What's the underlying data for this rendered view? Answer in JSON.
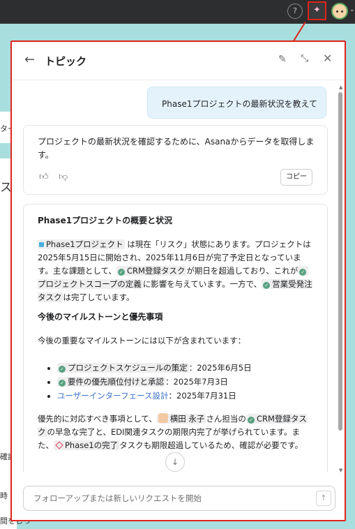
{
  "topbar": {
    "help_label": "?",
    "ai_icon": "sparkle-icon",
    "avatar_icon": "user-avatar",
    "chevron": "⌄"
  },
  "background": {
    "fragments": [
      "ター",
      "ス",
      "確認",
      "時",
      "間をしっ"
    ]
  },
  "panel": {
    "title": "トピック",
    "icons": [
      "back-arrow-icon",
      "edit-icon",
      "collapse-icon",
      "close-icon"
    ]
  },
  "conversation": {
    "user_message": "Phase1プロジェクトの最新状況を教えて",
    "assistant_intro": "プロジェクトの最新状況を確認するために、Asanaからデータを取得します。",
    "copy_label": "コピー",
    "answer": {
      "heading1": "Phase1プロジェクトの概要と状況",
      "p1": {
        "project_chip": "Phase1プロジェクト",
        "t1": "は現在「リスク」状態にあります。プロジェクトは2025年5月15日に開始され、2025年11月6日が完了予定日となっています。主な課題として、",
        "task1": "CRM登録タスク",
        "t2": "が期日を超過しており、これが",
        "task2": "プロジェクトスコープの定義",
        "t3": "に影響を与えています。一方で、",
        "task3": "営業受発注タスク",
        "t4": "は完了しています。"
      },
      "heading2": "今後のマイルストーンと優先事項",
      "p2": "今後の重要なマイルストーンには以下が含まれています：",
      "milestones": [
        {
          "name": "プロジェクトスケジュールの策定",
          "date": "：2025年6月5日"
        },
        {
          "name": "要件の優先順位付けと承認",
          "date": "：2025年7月3日"
        },
        {
          "name": "ユーザーインターフェース設計",
          "date": "：2025年7月31日"
        }
      ],
      "p3": {
        "t1": "優先的に対応すべき事項として、",
        "person": "横田 永子",
        "t2": "さん担当の",
        "task1": "CRM登録タスク",
        "t3": "の早急な完了と、EDI関連タスクの期限内完了が挙げられています。また、",
        "task2": "Phase1の完了",
        "t4": "タスクも期限超過しているため、確認が必要です。"
      }
    }
  },
  "composer": {
    "placeholder": "フォローアップまたは新しいリクエストを開始",
    "send_icon": "arrow-up-icon"
  }
}
